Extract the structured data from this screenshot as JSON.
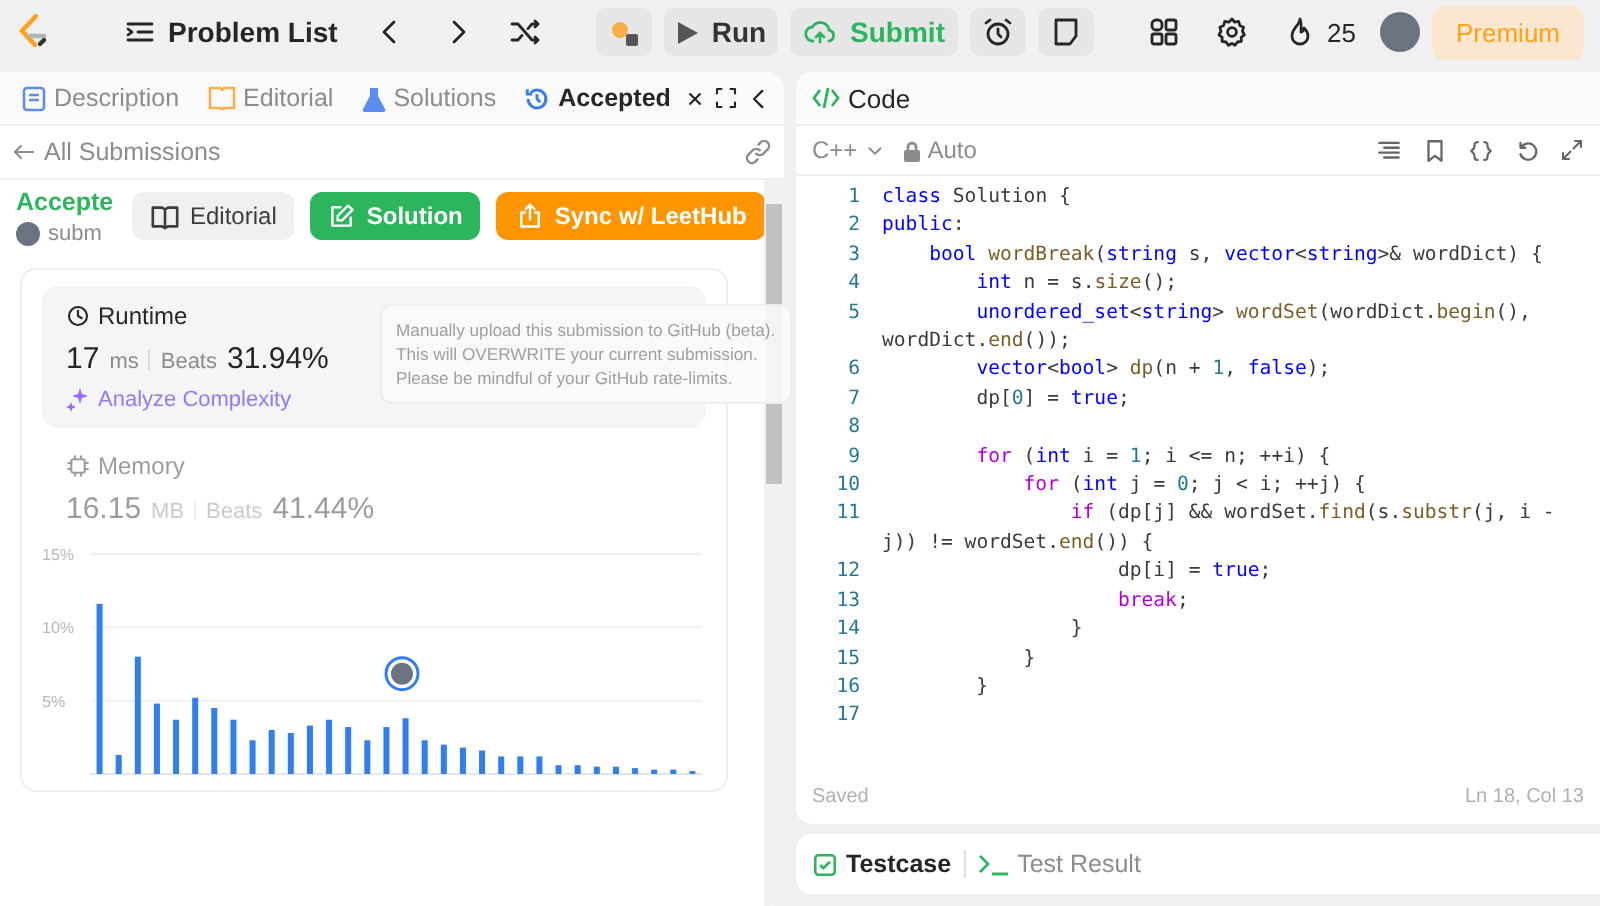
{
  "topbar": {
    "title": "Problem List",
    "run": "Run",
    "submit": "Submit",
    "streak": "25",
    "premium": "Premium"
  },
  "left_tabs": [
    {
      "label": "Description",
      "selected": false
    },
    {
      "label": "Editorial",
      "selected": false
    },
    {
      "label": "Solutions",
      "selected": false
    },
    {
      "label": "Accepted",
      "selected": true,
      "closable": true
    }
  ],
  "back_link": "All Submissions",
  "submission": {
    "status": "Accepte",
    "author": "subm",
    "buttons": [
      {
        "label": "Editorial",
        "kind": "plain"
      },
      {
        "label": "Solution",
        "kind": "green"
      },
      {
        "label": "Sync w/ LeetHub",
        "kind": "orange"
      }
    ]
  },
  "runtime": {
    "label": "Runtime",
    "value": "17",
    "unit": "ms",
    "beats_label": "Beats",
    "beats": "31.94%",
    "analyze": "Analyze Complexity"
  },
  "memory": {
    "label": "Memory",
    "value": "16.15",
    "unit": "MB",
    "beats_label": "Beats",
    "beats": "41.44%"
  },
  "chart_data": {
    "type": "bar",
    "yticks": [
      {
        "value": 5,
        "label": "5%"
      },
      {
        "value": 10,
        "label": "10%"
      },
      {
        "value": 15,
        "label": "15%"
      }
    ],
    "ylim": [
      0,
      15
    ],
    "values": [
      11.6,
      1.3,
      8.0,
      4.8,
      3.7,
      5.2,
      4.5,
      3.7,
      2.3,
      3.0,
      2.8,
      3.3,
      3.7,
      3.2,
      2.3,
      3.2,
      3.8,
      2.3,
      2.0,
      1.8,
      1.6,
      1.2,
      1.2,
      1.2,
      0.6,
      0.6,
      0.5,
      0.5,
      0.4,
      0.3,
      0.3,
      0.2
    ]
  },
  "tooltip": [
    "Manually upload this submission to GitHub (beta).",
    "This will OVERWRITE your current submission.",
    "Please be mindful of your GitHub rate-limits."
  ],
  "code_panel": {
    "title": "Code",
    "language": "C++",
    "mode": "Auto",
    "lines": [
      {
        "number": "1",
        "text": "class Solution {"
      },
      {
        "number": "2",
        "text": "public:"
      },
      {
        "number": "3",
        "text": "    bool wordBreak(string s, vector<string>& wordDict) {"
      },
      {
        "number": "4",
        "text": "        int n = s.size();"
      },
      {
        "number": "5",
        "text": "        unordered_set<string> wordSet(wordDict.begin(),"
      },
      {
        "text": "wordDict.end());"
      },
      {
        "number": "6",
        "text": "        vector<bool> dp(n + 1, false);"
      },
      {
        "number": "7",
        "text": "        dp[0] = true;"
      },
      {
        "number": "8"
      },
      {
        "number": "9",
        "text": "        for (int i = 1; i <= n; ++i) {"
      },
      {
        "number": "10",
        "text": "            for (int j = 0; j < i; ++j) {"
      },
      {
        "number": "11",
        "text": "                if (dp[j] && wordSet.find(s.substr(j, i -"
      },
      {
        "text": "j)) != wordSet.end()) {"
      },
      {
        "number": "12",
        "text": "                    dp[i] = true;"
      },
      {
        "number": "13",
        "text": "                    break;"
      },
      {
        "number": "14",
        "text": "                }"
      },
      {
        "number": "15",
        "text": "            }"
      },
      {
        "number": "16",
        "text": "        }"
      },
      {
        "number": "17"
      }
    ],
    "saved": "Saved",
    "cursor": "Ln 18, Col 13"
  },
  "bottom_tabs": [
    {
      "label": "Testcase",
      "selected": true
    },
    {
      "label": "Test Result",
      "selected": false
    }
  ]
}
